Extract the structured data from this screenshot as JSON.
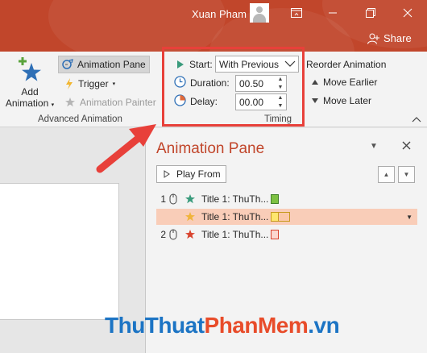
{
  "window": {
    "user_name": "Xuan Pham",
    "share_label": "Share",
    "accent_color": "#c1462b"
  },
  "advanced_animation": {
    "add_animation_line1": "Add",
    "add_animation_line2": "Animation",
    "animation_pane_label": "Animation Pane",
    "trigger_label": "Trigger",
    "animation_painter_label": "Animation Painter",
    "group_label": "Advanced Animation"
  },
  "timing": {
    "start_label": "Start:",
    "start_value": "With Previous",
    "duration_label": "Duration:",
    "duration_value": "00.50",
    "delay_label": "Delay:",
    "delay_value": "00.00",
    "group_label": "Timing",
    "reorder_label": "Reorder Animation",
    "move_earlier_label": "Move Earlier",
    "move_later_label": "Move Later"
  },
  "pane": {
    "title": "Animation Pane",
    "play_from_label": "Play From",
    "items": [
      {
        "number": "1",
        "label": "Title 1: ThuTh...",
        "star_color": "#3a9b7c",
        "bar_color": "#7dc142",
        "bar_border": "#3f7f27",
        "selected": false
      },
      {
        "number": "",
        "label": "Title 1: ThuTh...",
        "star_color": "#f0b43c",
        "bar_color": "#ffe66e",
        "bar_border": "#c89a1e",
        "selected": true
      },
      {
        "number": "2",
        "label": "Title 1: ThuTh...",
        "star_color": "#d8432e",
        "bar_color": "#fbd7d0",
        "bar_border": "#d8432e",
        "selected": false
      }
    ]
  },
  "watermark": {
    "part1": "ThuThuat",
    "part2": "PhanMem",
    "part3": ".vn"
  }
}
